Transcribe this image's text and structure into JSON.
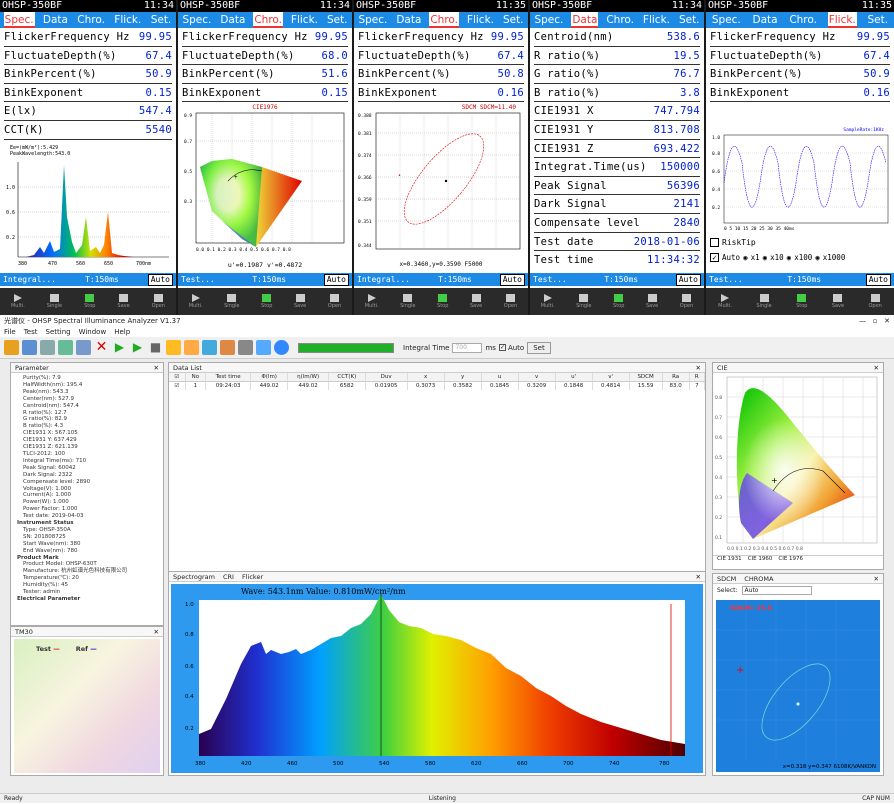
{
  "devices": [
    {
      "id": "spec",
      "model": "OHSP-350BF",
      "time": "11:34",
      "tabs": [
        "Spec.",
        "Data",
        "Chro.",
        "Flick.",
        "Set."
      ],
      "active_tab": 0,
      "rows": [
        {
          "label": "FlickerFrequency Hz",
          "value": "99.95"
        },
        {
          "label": "FluctuateDepth(%)",
          "value": "67.4"
        },
        {
          "label": "BinkPercent(%)",
          "value": "50.9"
        },
        {
          "label": "BinkExponent",
          "value": "0.15"
        },
        {
          "label": "E(lx)",
          "value": "547.4"
        },
        {
          "label": "CCT(K)",
          "value": "5540"
        }
      ],
      "status_left": "Integral...",
      "status_right": "T:150ms",
      "chart_line1": "Ee=(mW/m²):5.429",
      "chart_line2": "PeakWavelength:543.0",
      "auto": "Auto"
    },
    {
      "id": "chro",
      "model": "OHSP-350BF",
      "time": "11:34",
      "tabs": [
        "Spec.",
        "Data",
        "Chro.",
        "Flick.",
        "Set."
      ],
      "active_tab": 2,
      "rows": [
        {
          "label": "FlickerFrequency Hz",
          "value": "99.95"
        },
        {
          "label": "FluctuateDepth(%)",
          "value": "68.0"
        },
        {
          "label": "BinkPercent(%)",
          "value": "51.6"
        },
        {
          "label": "BinkExponent",
          "value": "0.15"
        }
      ],
      "chart_title": "CIE1976",
      "chart_footer": "u'=0.1987  v'=0.4872",
      "status_left": "Test...",
      "status_right": "T:150ms",
      "auto": "Auto"
    },
    {
      "id": "sdcm",
      "model": "OHSP-350BF",
      "time": "11:35",
      "tabs": [
        "Spec.",
        "Data",
        "Chro.",
        "Flick.",
        "Set."
      ],
      "active_tab": 2,
      "rows": [
        {
          "label": "FlickerFrequency Hz",
          "value": "99.95"
        },
        {
          "label": "FluctuateDepth(%)",
          "value": "67.4"
        },
        {
          "label": "BinkPercent(%)",
          "value": "50.8"
        },
        {
          "label": "BinkExponent",
          "value": "0.16"
        }
      ],
      "chart_title": "SDCM    SDCM=11.40",
      "chart_footer": "x=0.3460,y=0.3590 F5000",
      "status_left": "Integral...",
      "status_right": "T:150ms",
      "auto": "Auto"
    },
    {
      "id": "data",
      "model": "OHSP-350BF",
      "time": "11:34",
      "tabs": [
        "Spec.",
        "Data",
        "Chro.",
        "Flick.",
        "Set."
      ],
      "active_tab": 1,
      "rows": [
        {
          "label": "Centroid(nm)",
          "value": "538.6"
        },
        {
          "label": "R ratio(%)",
          "value": "19.5"
        },
        {
          "label": "G ratio(%)",
          "value": "76.7"
        },
        {
          "label": "B ratio(%)",
          "value": "3.8"
        },
        {
          "label": "CIE1931 X",
          "value": "747.794"
        },
        {
          "label": "CIE1931 Y",
          "value": "813.708"
        },
        {
          "label": "CIE1931 Z",
          "value": "693.422"
        },
        {
          "label": "Integrat.Time(us)",
          "value": "150000"
        },
        {
          "label": "Peak Signal",
          "value": "56396"
        },
        {
          "label": "Dark Signal",
          "value": "2141"
        },
        {
          "label": "Compensate level",
          "value": "2840"
        },
        {
          "label": "Test date",
          "value": "2018-01-06"
        },
        {
          "label": "Test time",
          "value": "11:34:32"
        }
      ],
      "status_left": "Test...",
      "status_right": "T:150ms",
      "auto": "Auto"
    },
    {
      "id": "flick",
      "model": "OHSP-350BF",
      "time": "11:35",
      "tabs": [
        "Spec.",
        "Data",
        "Chro.",
        "Flick.",
        "Set."
      ],
      "active_tab": 3,
      "rows": [
        {
          "label": "FlickerFrequency Hz",
          "value": "99.95"
        },
        {
          "label": "FluctuateDepth(%)",
          "value": "67.4"
        },
        {
          "label": "BinkPercent(%)",
          "value": "50.9"
        },
        {
          "label": "BinkExponent",
          "value": "0.16"
        }
      ],
      "chart_title": "SampleRate:1KHz",
      "risk_tip": "RiskTip",
      "mult_options": [
        "Auto",
        "x1",
        "x10",
        "x100",
        "x1000"
      ],
      "status_left": "Test...",
      "status_right": "T:150ms",
      "auto": "Auto"
    }
  ],
  "controls": [
    "Multi.",
    "Single",
    "Stop",
    "Save",
    "Open"
  ],
  "pc": {
    "title": "光谱仪 - OHSP Spectral Illuminance Analyzer V1.37",
    "menu": [
      "File",
      "Test",
      "Setting",
      "Window",
      "Help"
    ],
    "integral_label": "Integral Time",
    "integral_value": "700",
    "integral_unit": "ms",
    "auto_label": "Auto",
    "set_label": "Set",
    "parameter_title": "Parameter",
    "parameters": [
      "Purity(%): 7.9",
      "HalfWidth(nm): 195.4",
      "Peak(nm): 543.3",
      "Center(nm): 527.9",
      "Centroid(nm): 547.4",
      "R ratio(%): 12.7",
      "G ratio(%): 82.9",
      "B ratio(%): 4.3",
      "CIE1931 X: 567.105",
      "CIE1931 Y: 637.429",
      "CIE1931 Z: 621.139",
      "TLCI-2012: 100",
      "Integral Time(ms): 710",
      "Peak Signal: 60042",
      "Dark Signal: 2322",
      "Compensate level: 2890",
      "Voltage(V): 1.000",
      "Current(A): 1.000",
      "Power(W): 1.000",
      "Power Factor: 1.000",
      "Test date: 2019-04-03",
      "Instrument Status",
      "Type: OHSP-350A",
      "SN: 201808725",
      "Start Wave(nm): 380",
      "End Wave(nm): 780",
      "Product Mark",
      "Product Model: OHSP-630T",
      "Manufacture: 杭州虹谱光色科技有限公司",
      "Temperature(℃): 20",
      "Humidity(%): 45",
      "Tester: admin",
      "Electrical Parameter"
    ],
    "datalist_title": "Data List",
    "columns": [
      "No",
      "Test time",
      "Φ(lm)",
      "η(lm/W)",
      "CCT(K)",
      "Duv",
      "x",
      "y",
      "u",
      "v",
      "u'",
      "v'",
      "SDCM",
      "Ra",
      "R"
    ],
    "rows": [
      [
        "1",
        "09:24:03",
        "449.02",
        "449.02",
        "6582",
        "0.01905",
        "0.3073",
        "0.3582",
        "0.1845",
        "0.3209",
        "0.1848",
        "0.4814",
        "15.59",
        "83.0",
        "7"
      ]
    ],
    "cie_title": "CIE",
    "cie_tabs": [
      "CIE 1931",
      "CIE 1960",
      "CIE 1976"
    ],
    "spectrogram_tabs": [
      "Spectrogram",
      "CRI",
      "Flicker"
    ],
    "spectrum_label": "Wave: 543.1nm Value: 0.810mW/cm²/nm",
    "sdcm_tabs": [
      "SDCM",
      "CHROMA"
    ],
    "select_label": "Select:",
    "select_value": "Auto",
    "sdcm_value": "SDCM: 15.6",
    "sdcm_footer": "x=0.318 y=0.347 6108K/VANKON",
    "tm30_title": "TM30",
    "tm30_test": "Test",
    "tm30_ref": "Ref",
    "status_ready": "Ready",
    "status_listening": "Listening",
    "status_right": "CAP  NUM"
  }
}
